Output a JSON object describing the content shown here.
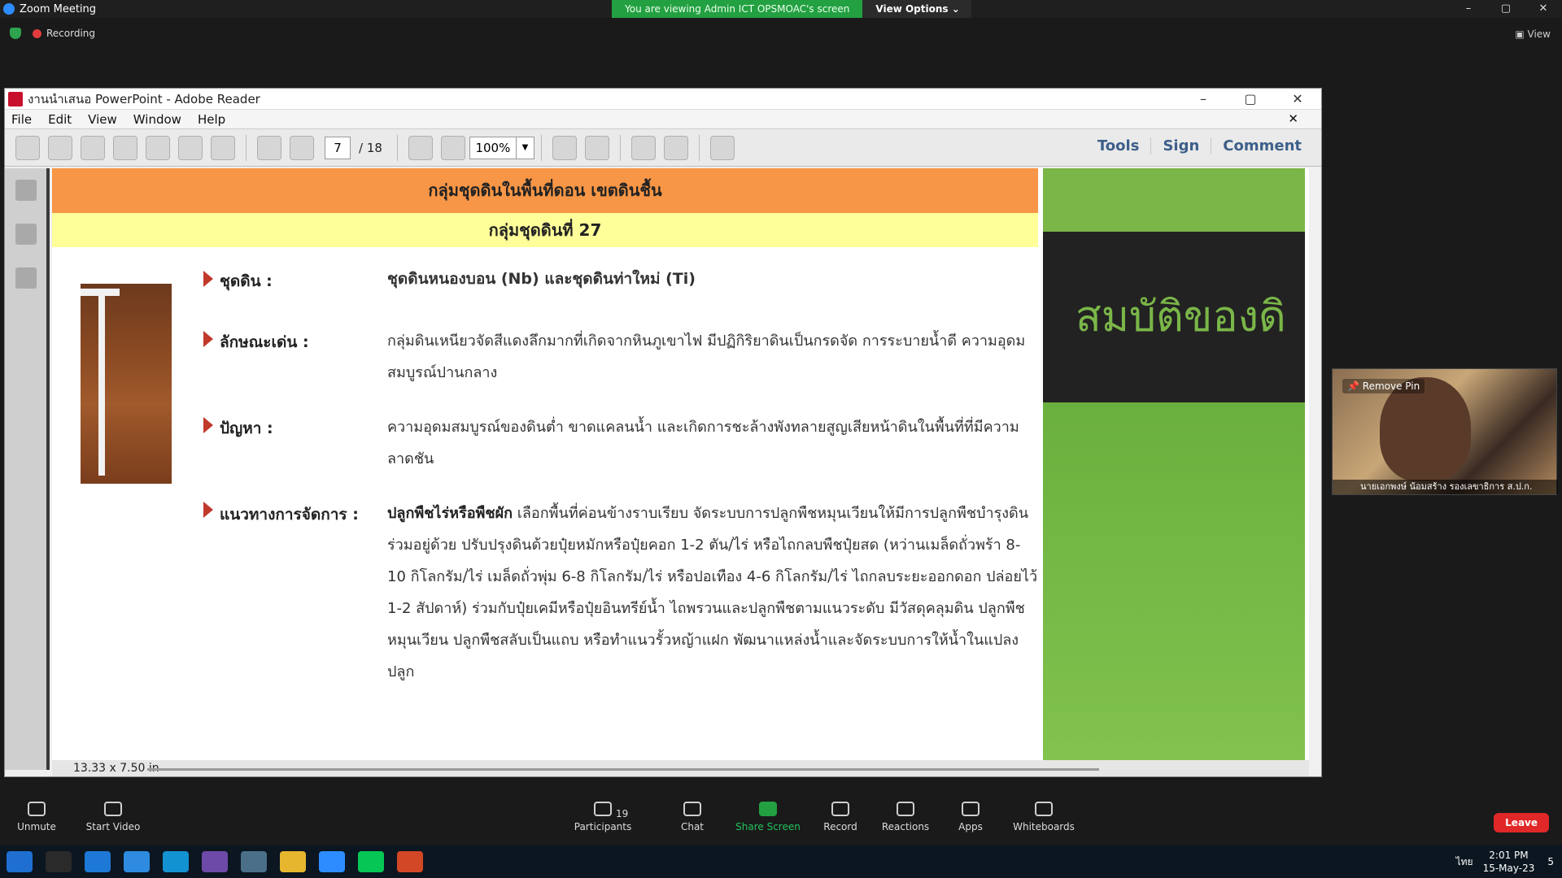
{
  "zoom": {
    "app_title": "Zoom Meeting",
    "banner_text": "You are viewing Admin ICT OPSMOAC's screen",
    "view_options": "View Options",
    "recording": "Recording",
    "view_label": "View",
    "minimize": "–",
    "restore": "▢",
    "close": "✕"
  },
  "reader": {
    "title": "งานนำเสนอ PowerPoint - Adobe Reader",
    "menu": [
      "File",
      "Edit",
      "View",
      "Window",
      "Help"
    ],
    "page_current": "7",
    "page_total": "/ 18",
    "zoom": "100%",
    "tools": "Tools",
    "sign": "Sign",
    "comment": "Comment",
    "page_size": "13.33 x 7.50 in"
  },
  "slide": {
    "header_orange": "กลุ่มชุดดินในพื้นที่ดอน เขตดินชื้น",
    "header_yellow": "กลุ่มชุดดินที่ 27",
    "rows": [
      {
        "label": "ชุดดิน :",
        "value": "ชุดดินหนองบอน (Nb) และชุดดินท่าใหม่ (Ti)"
      },
      {
        "label": "ลักษณะเด่น :",
        "value": "กลุ่มดินเหนียวจัดสีแดงลึกมากที่เกิดจากหินภูเขาไฟ มีปฏิกิริยาดินเป็นกรดจัด การระบายน้ำดี ความอุดมสมบูรณ์ปานกลาง"
      },
      {
        "label": "ปัญหา :",
        "value": "ความอุดมสมบูรณ์ของดินต่ำ ขาดแคลนน้ำ และเกิดการชะล้างพังทลายสูญเสียหน้าดินในพื้นที่ที่มีความลาดชัน"
      },
      {
        "label": "แนวทางการจัดการ :",
        "value_bold": "ปลูกพืชไร่หรือพืชผัก",
        "value": " เลือกพื้นที่ค่อนข้างราบเรียบ จัดระบบการปลูกพืชหมุนเวียนให้มีการปลูกพืชบำรุงดินร่วมอยู่ด้วย ปรับปรุงดินด้วยปุ๋ยหมักหรือปุ๋ยคอก 1-2 ตัน/ไร่ หรือไถกลบพืชปุ๋ยสด (หว่านเมล็ดถั่วพร้า 8-10 กิโลกรัม/ไร่ เมล็ดถั่วพุ่ม 6-8 กิโลกรัม/ไร่ หรือปอเทือง 4-6 กิโลกรัม/ไร่ ไถกลบระยะออกดอก ปล่อยไว้ 1-2 สัปดาห์) ร่วมกับปุ๋ยเคมีหรือปุ๋ยอินทรีย์น้ำ ไถพรวนและปลูกพืชตามแนวระดับ มีวัสดุคลุมดิน ปลูกพืชหมุนเวียน ปลูกพืชสลับเป็นแถบ หรือทำแนวรั้วหญ้าแฝก พัฒนาแหล่งน้ำและจัดระบบการให้น้ำในแปลงปลูก"
      }
    ],
    "side_title": "สมบัติของดิ"
  },
  "video": {
    "pin_label": "Remove Pin",
    "name": "นายเอกพงษ์ น้อมสร้าง รองเลขาธิการ ส.ป.ก."
  },
  "toolbar_bottom": {
    "unmute": "Unmute",
    "start_video": "Start Video",
    "participants": "Participants",
    "participant_count": "19",
    "chat": "Chat",
    "share_screen": "Share Screen",
    "record": "Record",
    "reactions": "Reactions",
    "apps": "Apps",
    "whiteboards": "Whiteboards",
    "leave": "Leave"
  },
  "taskbar": {
    "time": "2:01 PM",
    "date": "15-May-23",
    "lang": "ไทย",
    "notif_count": "5"
  }
}
